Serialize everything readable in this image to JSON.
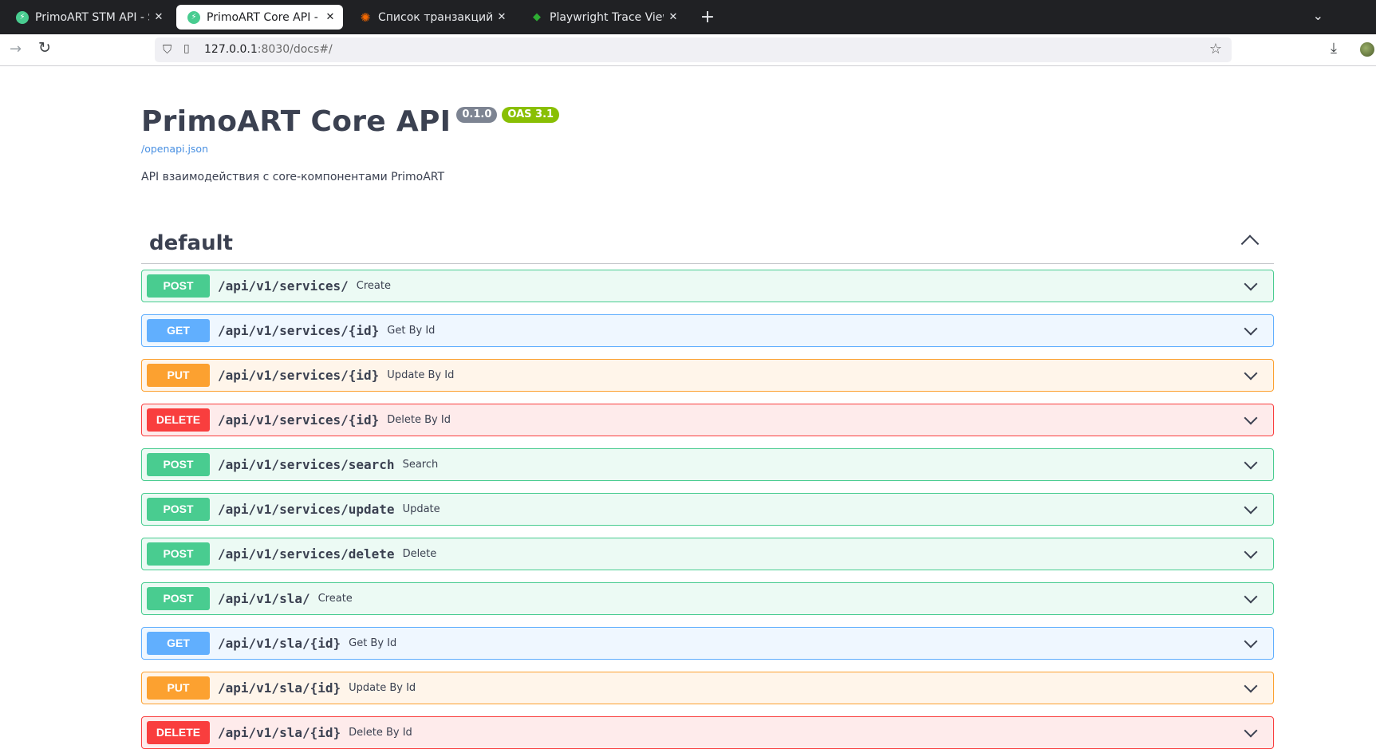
{
  "browser": {
    "tabs": [
      {
        "title": "PrimoART STM API - Swagger",
        "icon": "swagger-icon",
        "active": false
      },
      {
        "title": "PrimoART Core API - Swagger",
        "icon": "swagger-icon",
        "active": true
      },
      {
        "title": "Список транзакций DEV",
        "icon": "grafana-icon",
        "active": false
      },
      {
        "title": "Playwright Trace Viewer",
        "icon": "playwright-icon",
        "active": false
      }
    ],
    "new_tab": "+",
    "url_host": "127.0.0.1",
    "url_rest": ":8030/docs#/"
  },
  "page": {
    "title": "PrimoART Core API",
    "version_badge": "0.1.0",
    "oas_badge": "OAS 3.1",
    "spec_link": "/openapi.json",
    "description": "API взаимодействия с core-компонентами PrimoART"
  },
  "section": {
    "title": "default"
  },
  "operations": [
    {
      "method": "POST",
      "path": "/api/v1/services/",
      "summary": "Create"
    },
    {
      "method": "GET",
      "path": "/api/v1/services/{id}",
      "summary": "Get By Id"
    },
    {
      "method": "PUT",
      "path": "/api/v1/services/{id}",
      "summary": "Update By Id"
    },
    {
      "method": "DELETE",
      "path": "/api/v1/services/{id}",
      "summary": "Delete By Id"
    },
    {
      "method": "POST",
      "path": "/api/v1/services/search",
      "summary": "Search"
    },
    {
      "method": "POST",
      "path": "/api/v1/services/update",
      "summary": "Update"
    },
    {
      "method": "POST",
      "path": "/api/v1/services/delete",
      "summary": "Delete"
    },
    {
      "method": "POST",
      "path": "/api/v1/sla/",
      "summary": "Create"
    },
    {
      "method": "GET",
      "path": "/api/v1/sla/{id}",
      "summary": "Get By Id"
    },
    {
      "method": "PUT",
      "path": "/api/v1/sla/{id}",
      "summary": "Update By Id"
    },
    {
      "method": "DELETE",
      "path": "/api/v1/sla/{id}",
      "summary": "Delete By Id"
    }
  ],
  "colors": {
    "post": "#49cc90",
    "get": "#61affe",
    "put": "#fca130",
    "delete": "#f93e3e"
  }
}
